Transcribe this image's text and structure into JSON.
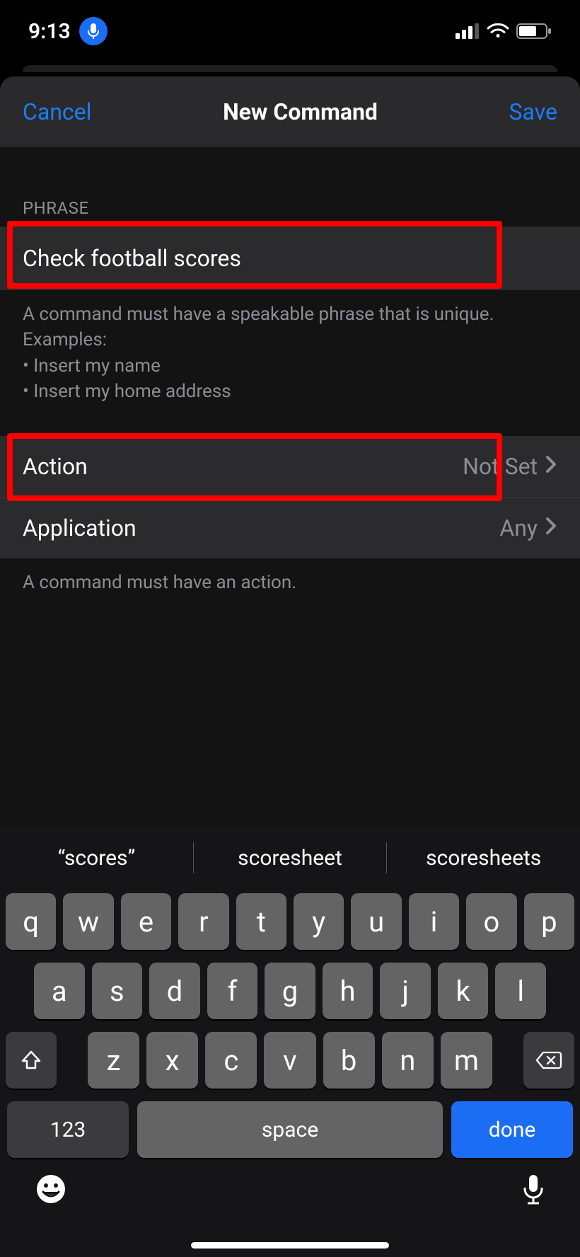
{
  "status": {
    "time": "9:13"
  },
  "nav": {
    "cancel": "Cancel",
    "title": "New Command",
    "save": "Save"
  },
  "phrase": {
    "header": "PHRASE",
    "value": "Check football scores",
    "help_line1": "A command must have a speakable phrase that is unique.",
    "help_line2": "Examples:",
    "help_bullet1": "• Insert my name",
    "help_bullet2": "• Insert my home address"
  },
  "rows": {
    "action_label": "Action",
    "action_value": "Not Set",
    "application_label": "Application",
    "application_value": "Any",
    "footer": "A command must have an action."
  },
  "keyboard": {
    "suggestions": [
      "“scores”",
      "scoresheet",
      "scoresheets"
    ],
    "row1": [
      "q",
      "w",
      "e",
      "r",
      "t",
      "y",
      "u",
      "i",
      "o",
      "p"
    ],
    "row2": [
      "a",
      "s",
      "d",
      "f",
      "g",
      "h",
      "j",
      "k",
      "l"
    ],
    "row3": [
      "z",
      "x",
      "c",
      "v",
      "b",
      "n",
      "m"
    ],
    "numKey": "123",
    "spaceKey": "space",
    "doneKey": "done"
  }
}
